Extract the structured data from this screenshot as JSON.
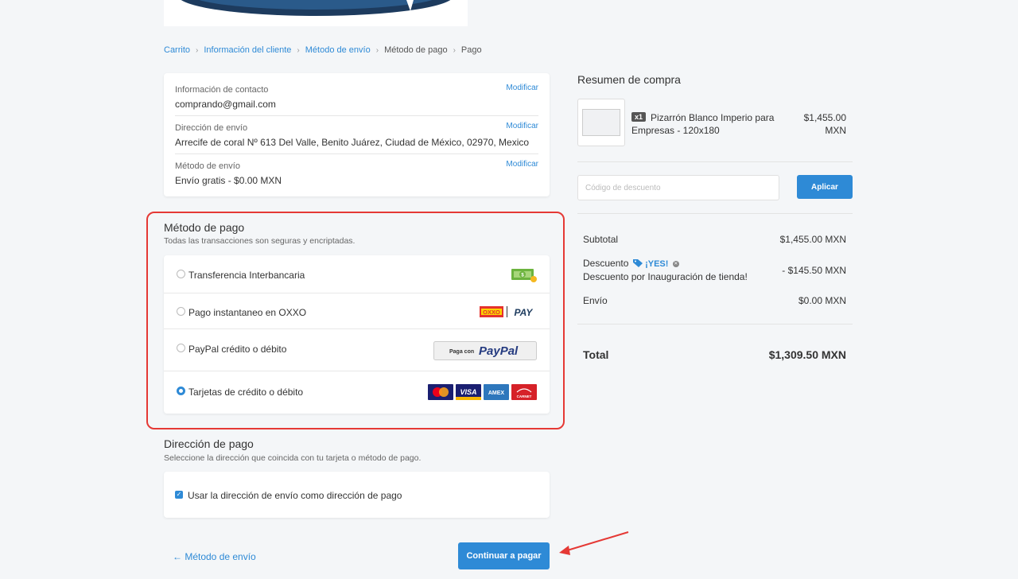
{
  "breadcrumb": {
    "items": [
      {
        "label": "Carrito",
        "link": true
      },
      {
        "label": "Información del cliente",
        "link": true
      },
      {
        "label": "Método de envío",
        "link": true
      },
      {
        "label": "Método de pago",
        "link": false
      },
      {
        "label": "Pago",
        "link": false
      }
    ]
  },
  "info": {
    "contact_label": "Información de contacto",
    "contact_value": "comprando@gmail.com",
    "address_label": "Dirección de envío",
    "address_value": "Arrecife de coral Nº 613 Del Valle, Benito Juárez, Ciudad de México, 02970, Mexico",
    "shipping_label": "Método de envío",
    "shipping_value": "Envío gratis - $0.00 MXN",
    "modify_label": "Modificar"
  },
  "payment": {
    "title": "Método de pago",
    "subtitle": "Todas las transacciones son seguras y encriptadas.",
    "options": [
      {
        "label": "Transferencia Interbancaria",
        "selected": false,
        "icon": "cash-icon"
      },
      {
        "label": "Pago instantaneo en OXXO",
        "selected": false,
        "icon": "oxxo-pay-logo"
      },
      {
        "label": "PayPal crédito o débito",
        "selected": false,
        "icon": "paypal-button"
      },
      {
        "label": "Tarjetas de crédito o débito",
        "selected": true,
        "icon": "card-brands"
      }
    ],
    "oxxo_text": "OXXO",
    "pay_text": "PAY",
    "paypal_prefix": "Paga con",
    "paypal_word": "PayPal",
    "cards": [
      "VISA",
      "AMEX",
      "CARNET"
    ]
  },
  "billing": {
    "title": "Dirección de pago",
    "subtitle": "Seleccione la dirección que coincida con tu tarjeta o método de pago.",
    "same_address_label": "Usar la dirección de envío como dirección de pago",
    "same_address_checked": true
  },
  "actions": {
    "back_label": "← Método de envío",
    "continue_label": "Continuar a pagar"
  },
  "summary": {
    "title": "Resumen de compra",
    "product": {
      "qty": "x1",
      "name": "Pizarrón Blanco Imperio para Empresas - 120x180",
      "price": "$1,455.00 MXN"
    },
    "discount_placeholder": "Código de descuento",
    "apply_label": "Aplicar",
    "subtotal_label": "Subtotal",
    "subtotal_value": "$1,455.00 MXN",
    "discount_label": "Descuento",
    "discount_code": "¡YES!",
    "discount_desc": "Descuento por Inauguración de tienda!",
    "discount_value": "- $145.50 MXN",
    "shipping_label": "Envío",
    "shipping_value": "$0.00 MXN",
    "total_label": "Total",
    "total_value": "$1,309.50 MXN"
  },
  "colors": {
    "accent": "#2e8ad6",
    "highlight": "#e53935",
    "background": "#f4f6f8"
  }
}
